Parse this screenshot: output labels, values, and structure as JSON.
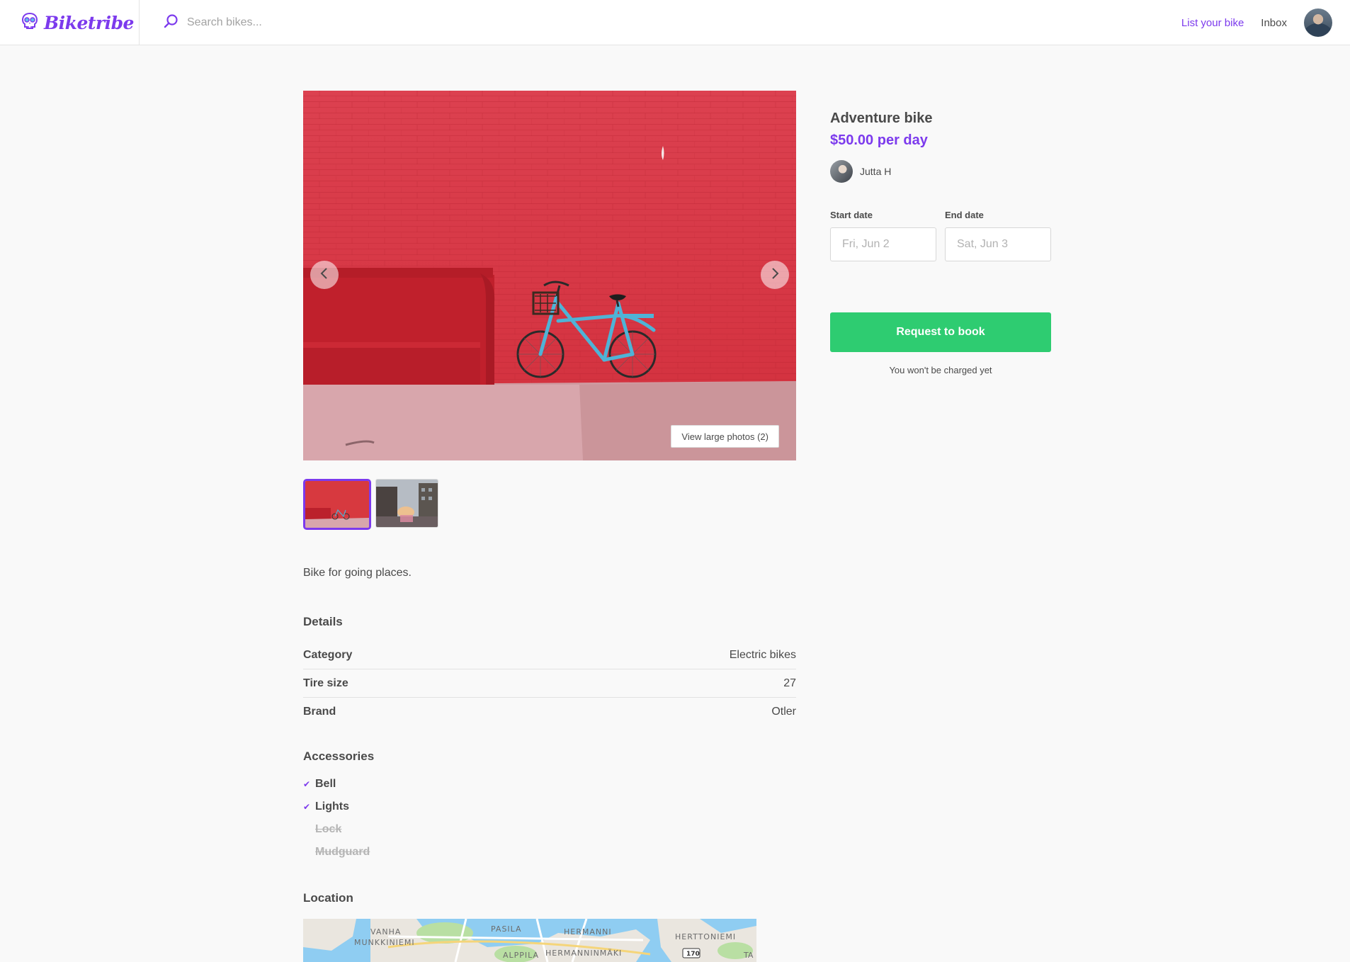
{
  "brand": {
    "name": "Biketribe",
    "accent": "#7c3aed",
    "cta": "#2ecc71"
  },
  "search": {
    "placeholder": "Search bikes..."
  },
  "nav": {
    "list_bike": "List your bike",
    "inbox": "Inbox"
  },
  "gallery": {
    "view_large": "View large photos (2)",
    "thumbnails": [
      "red-wall-bike-photo",
      "street-sunset-photo"
    ],
    "selected_index": 0
  },
  "listing": {
    "title": "Adventure bike",
    "price": "$50.00 per day",
    "author": "Jutta H",
    "description": "Bike for going places."
  },
  "details": {
    "heading": "Details",
    "rows": [
      {
        "key": "Category",
        "value": "Electric bikes"
      },
      {
        "key": "Tire size",
        "value": "27"
      },
      {
        "key": "Brand",
        "value": "Otler"
      }
    ]
  },
  "accessories": {
    "heading": "Accessories",
    "items": [
      {
        "label": "Bell",
        "included": true
      },
      {
        "label": "Lights",
        "included": true
      },
      {
        "label": "Lock",
        "included": false
      },
      {
        "label": "Mudguard",
        "included": false
      }
    ]
  },
  "location": {
    "heading": "Location",
    "map_labels": [
      "VANHA",
      "MUNKKINIEMI",
      "PASILA",
      "HERMANNI",
      "ALPPILA",
      "HERMANNINMÄKI",
      "HERTTONIEMI",
      "170",
      "TA"
    ]
  },
  "booking": {
    "start_label": "Start date",
    "start_placeholder": "Fri, Jun 2",
    "end_label": "End date",
    "end_placeholder": "Sat, Jun 3",
    "button": "Request to book",
    "note": "You won't be charged yet"
  }
}
